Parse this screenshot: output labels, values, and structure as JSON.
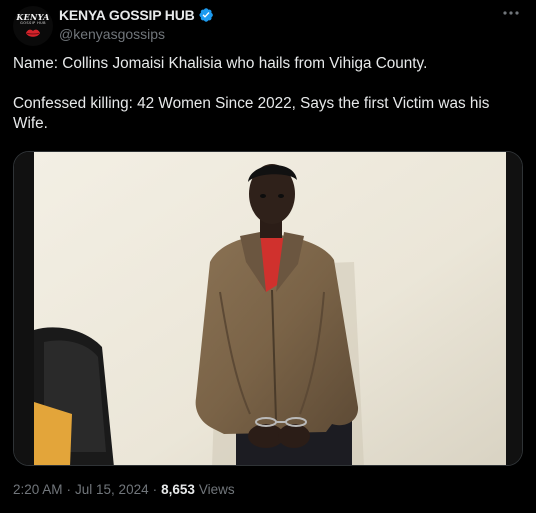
{
  "author": {
    "display_name": "KENYA GOSSIP HUB",
    "handle": "@kenyasgossips",
    "avatar_logo_text": "KENYA",
    "avatar_logo_subtext": "GOSSIP HUB",
    "verified": true
  },
  "tweet": {
    "text": "Name: Collins Jomaisi Khalisia who hails from Vihiga County.\n\nConfessed killing: 42 Women Since 2022, Says the first Victim was his Wife."
  },
  "media": {
    "kind": "photo"
  },
  "meta": {
    "time": "2:20 AM",
    "date": "Jul 15, 2024",
    "separator": "·",
    "views_count": "8,653",
    "views_label": "Views"
  },
  "colors": {
    "background": "#000000",
    "text_primary": "#e7e9ea",
    "text_secondary": "#71767b",
    "verified_blue": "#1d9bf0",
    "border": "#2f3336"
  },
  "icons": {
    "verified": "verified-badge-icon",
    "more": "more-options-icon"
  }
}
